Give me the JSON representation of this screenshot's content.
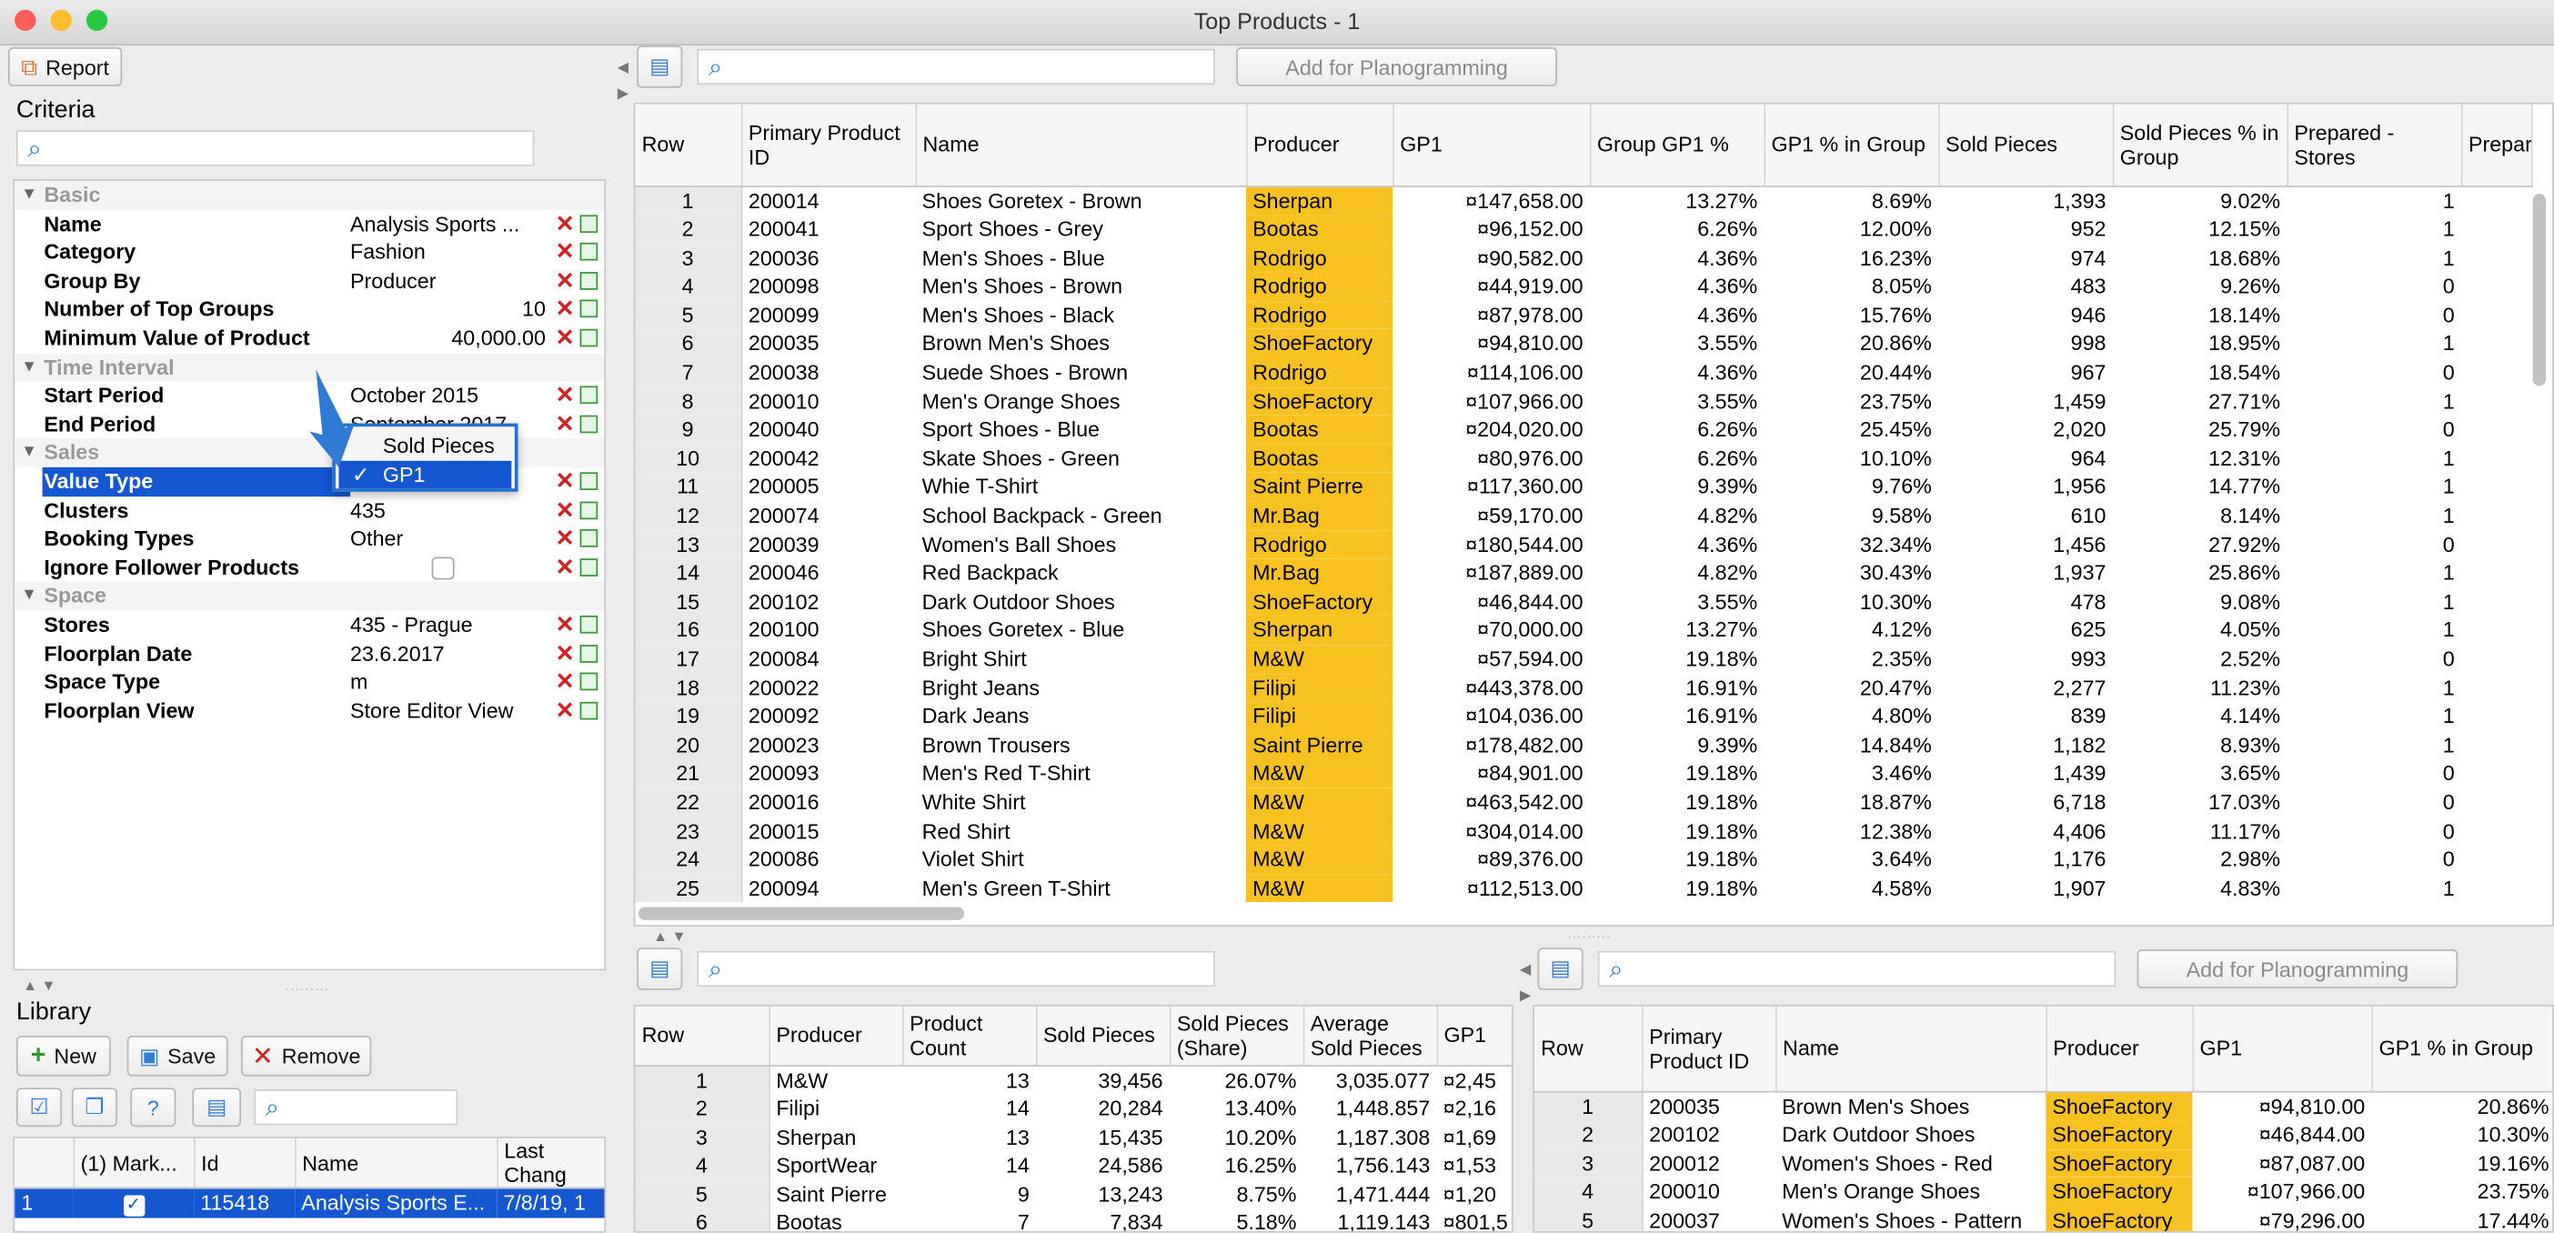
{
  "window": {
    "title": "Top Products - 1"
  },
  "toolbar": {
    "report_label": "Report"
  },
  "criteria": {
    "title": "Criteria",
    "sections": [
      {
        "label": "Basic",
        "rows": [
          {
            "key": "Name",
            "value": "Analysis Sports ...",
            "align": "left"
          },
          {
            "key": "Category",
            "value": "Fashion",
            "align": "left"
          },
          {
            "key": "Group By",
            "value": "Producer",
            "align": "left"
          },
          {
            "key": "Number of Top Groups",
            "value": "10",
            "align": "right"
          },
          {
            "key": "Minimum Value of Product",
            "value": "40,000.00",
            "align": "right"
          }
        ]
      },
      {
        "label": "Time Interval",
        "rows": [
          {
            "key": "Start Period",
            "value": "October 2015",
            "align": "left"
          },
          {
            "key": "End Period",
            "value": "September 2017",
            "align": "left"
          }
        ]
      },
      {
        "label": "Sales",
        "rows": [
          {
            "key": "Value Type",
            "value": "",
            "align": "left",
            "selected": true
          },
          {
            "key": "Clusters",
            "value": "435",
            "align": "left"
          },
          {
            "key": "Booking Types",
            "value": "Other",
            "align": "left"
          },
          {
            "key": "Ignore Follower Products",
            "value": "",
            "align": "left",
            "checkbox": true
          }
        ]
      },
      {
        "label": "Space",
        "rows": [
          {
            "key": "Stores",
            "value": "435 - Prague",
            "align": "left"
          },
          {
            "key": "Floorplan Date",
            "value": "23.6.2017",
            "align": "left"
          },
          {
            "key": "Space Type",
            "value": "m",
            "align": "left"
          },
          {
            "key": "Floorplan View",
            "value": "Store Editor View",
            "align": "left"
          }
        ]
      }
    ],
    "value_type_options": [
      "Sold Pieces",
      "GP1"
    ],
    "value_type_selected": "GP1",
    "check_mark": "✓"
  },
  "library": {
    "title": "Library",
    "new_label": "New",
    "save_label": "Save",
    "remove_label": "Remove",
    "columns": [
      "(1) Mark...",
      "Id",
      "Name",
      "Last Chang"
    ],
    "rows": [
      {
        "row": "1",
        "id": "115418",
        "name": "Analysis Sports E...",
        "last": "7/8/19, 1"
      }
    ]
  },
  "top_toolbar": {
    "add_label": "Add for Planogramming"
  },
  "products_table": {
    "columns": [
      "Row",
      "Primary Product ID",
      "Name",
      "Producer",
      "GP1",
      "Group GP1 %",
      "GP1 % in Group",
      "Sold Pieces",
      "Sold Pieces % in Group",
      "Prepared - Stores",
      "Prepar"
    ],
    "rows": [
      [
        "1",
        "200014",
        "Shoes Goretex - Brown",
        "Sherpan",
        "¤147,658.00",
        "13.27%",
        "8.69%",
        "1,393",
        "9.02%",
        "1"
      ],
      [
        "2",
        "200041",
        "Sport Shoes - Grey",
        "Bootas",
        "¤96,152.00",
        "6.26%",
        "12.00%",
        "952",
        "12.15%",
        "1"
      ],
      [
        "3",
        "200036",
        "Men's Shoes - Blue",
        "Rodrigo",
        "¤90,582.00",
        "4.36%",
        "16.23%",
        "974",
        "18.68%",
        "1"
      ],
      [
        "4",
        "200098",
        "Men's Shoes - Brown",
        "Rodrigo",
        "¤44,919.00",
        "4.36%",
        "8.05%",
        "483",
        "9.26%",
        "0"
      ],
      [
        "5",
        "200099",
        "Men's Shoes - Black",
        "Rodrigo",
        "¤87,978.00",
        "4.36%",
        "15.76%",
        "946",
        "18.14%",
        "0"
      ],
      [
        "6",
        "200035",
        "Brown Men's Shoes",
        "ShoeFactory",
        "¤94,810.00",
        "3.55%",
        "20.86%",
        "998",
        "18.95%",
        "1"
      ],
      [
        "7",
        "200038",
        "Suede Shoes - Brown",
        "Rodrigo",
        "¤114,106.00",
        "4.36%",
        "20.44%",
        "967",
        "18.54%",
        "0"
      ],
      [
        "8",
        "200010",
        "Men's Orange Shoes",
        "ShoeFactory",
        "¤107,966.00",
        "3.55%",
        "23.75%",
        "1,459",
        "27.71%",
        "1"
      ],
      [
        "9",
        "200040",
        "Sport Shoes - Blue",
        "Bootas",
        "¤204,020.00",
        "6.26%",
        "25.45%",
        "2,020",
        "25.79%",
        "0"
      ],
      [
        "10",
        "200042",
        "Skate Shoes - Green",
        "Bootas",
        "¤80,976.00",
        "6.26%",
        "10.10%",
        "964",
        "12.31%",
        "1"
      ],
      [
        "11",
        "200005",
        "Whie T-Shirt",
        "Saint Pierre",
        "¤117,360.00",
        "9.39%",
        "9.76%",
        "1,956",
        "14.77%",
        "1"
      ],
      [
        "12",
        "200074",
        "School Backpack - Green",
        "Mr.Bag",
        "¤59,170.00",
        "4.82%",
        "9.58%",
        "610",
        "8.14%",
        "1"
      ],
      [
        "13",
        "200039",
        "Women's Ball Shoes",
        "Rodrigo",
        "¤180,544.00",
        "4.36%",
        "32.34%",
        "1,456",
        "27.92%",
        "0"
      ],
      [
        "14",
        "200046",
        "Red Backpack",
        "Mr.Bag",
        "¤187,889.00",
        "4.82%",
        "30.43%",
        "1,937",
        "25.86%",
        "1"
      ],
      [
        "15",
        "200102",
        "Dark Outdoor Shoes",
        "ShoeFactory",
        "¤46,844.00",
        "3.55%",
        "10.30%",
        "478",
        "9.08%",
        "1"
      ],
      [
        "16",
        "200100",
        "Shoes Goretex - Blue",
        "Sherpan",
        "¤70,000.00",
        "13.27%",
        "4.12%",
        "625",
        "4.05%",
        "1"
      ],
      [
        "17",
        "200084",
        "Bright Shirt",
        "M&W",
        "¤57,594.00",
        "19.18%",
        "2.35%",
        "993",
        "2.52%",
        "0"
      ],
      [
        "18",
        "200022",
        "Bright Jeans",
        "Filipi",
        "¤443,378.00",
        "16.91%",
        "20.47%",
        "2,277",
        "11.23%",
        "1"
      ],
      [
        "19",
        "200092",
        "Dark Jeans",
        "Filipi",
        "¤104,036.00",
        "16.91%",
        "4.80%",
        "839",
        "4.14%",
        "1"
      ],
      [
        "20",
        "200023",
        "Brown Trousers",
        "Saint Pierre",
        "¤178,482.00",
        "9.39%",
        "14.84%",
        "1,182",
        "8.93%",
        "1"
      ],
      [
        "21",
        "200093",
        "Men's Red T-Shirt",
        "M&W",
        "¤84,901.00",
        "19.18%",
        "3.46%",
        "1,439",
        "3.65%",
        "0"
      ],
      [
        "22",
        "200016",
        "White Shirt",
        "M&W",
        "¤463,542.00",
        "19.18%",
        "18.87%",
        "6,718",
        "17.03%",
        "0"
      ],
      [
        "23",
        "200015",
        "Red Shirt",
        "M&W",
        "¤304,014.00",
        "19.18%",
        "12.38%",
        "4,406",
        "11.17%",
        "0"
      ],
      [
        "24",
        "200086",
        "Violet Shirt",
        "M&W",
        "¤89,376.00",
        "19.18%",
        "3.64%",
        "1,176",
        "2.98%",
        "0"
      ],
      [
        "25",
        "200094",
        "Men's Green T-Shirt",
        "M&W",
        "¤112,513.00",
        "19.18%",
        "4.58%",
        "1,907",
        "4.83%",
        "1"
      ]
    ]
  },
  "producers_table": {
    "columns": [
      "Row",
      "Producer",
      "Product Count",
      "Sold Pieces",
      "Sold Pieces (Share)",
      "Average Sold Pieces",
      "GP1"
    ],
    "rows": [
      [
        "1",
        "M&W",
        "13",
        "39,456",
        "26.07%",
        "3,035.077",
        "¤2,45"
      ],
      [
        "2",
        "Filipi",
        "14",
        "20,284",
        "13.40%",
        "1,448.857",
        "¤2,16"
      ],
      [
        "3",
        "Sherpan",
        "13",
        "15,435",
        "10.20%",
        "1,187.308",
        "¤1,69"
      ],
      [
        "4",
        "SportWear",
        "14",
        "24,586",
        "16.25%",
        "1,756.143",
        "¤1,53"
      ],
      [
        "5",
        "Saint Pierre",
        "9",
        "13,243",
        "8.75%",
        "1,471.444",
        "¤1,20"
      ],
      [
        "6",
        "Bootas",
        "7",
        "7,834",
        "5.18%",
        "1,119.143",
        "¤801,5"
      ]
    ]
  },
  "group_toolbar": {
    "add_label": "Add for Planogramming"
  },
  "group_table": {
    "columns": [
      "Row",
      "Primary Product ID",
      "Name",
      "Producer",
      "GP1",
      "GP1 % in Group"
    ],
    "rows": [
      [
        "1",
        "200035",
        "Brown Men's Shoes",
        "ShoeFactory",
        "¤94,810.00",
        "20.86%"
      ],
      [
        "2",
        "200102",
        "Dark Outdoor Shoes",
        "ShoeFactory",
        "¤46,844.00",
        "10.30%"
      ],
      [
        "3",
        "200012",
        "Women's Shoes - Red",
        "ShoeFactory",
        "¤87,087.00",
        "19.16%"
      ],
      [
        "4",
        "200010",
        "Men's Orange Shoes",
        "ShoeFactory",
        "¤107,966.00",
        "23.75%"
      ],
      [
        "5",
        "200037",
        "Women's Shoes - Pattern",
        "ShoeFactory",
        "¤79,296.00",
        "17.44%"
      ]
    ]
  },
  "colors": {
    "selection": "#1457d1",
    "producer_highlight": "#f7c21f",
    "accent": "#2f7fd8"
  }
}
